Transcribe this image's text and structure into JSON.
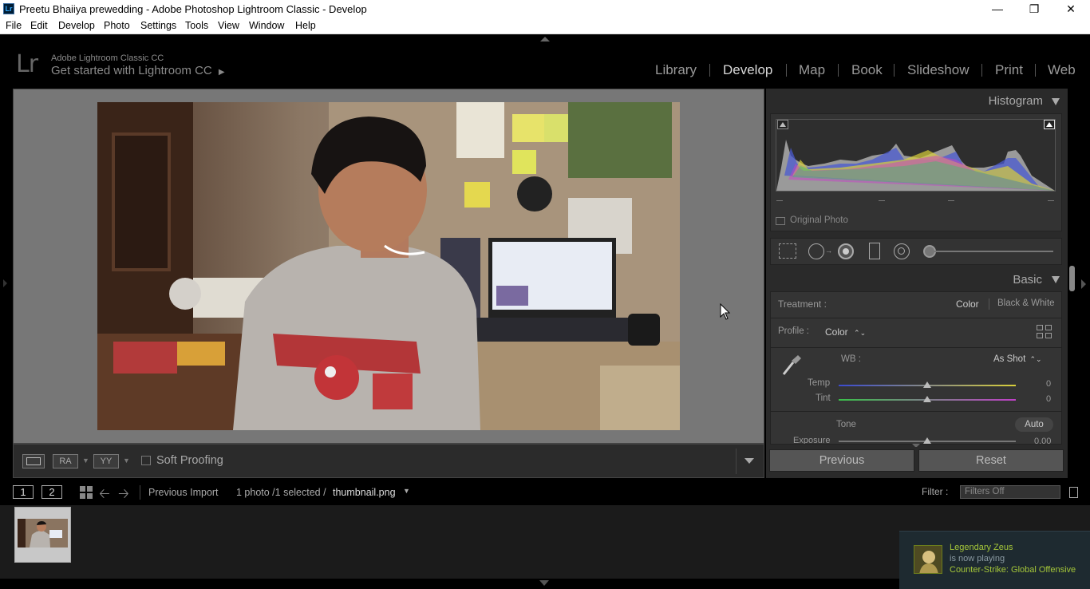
{
  "window": {
    "title": "Preetu Bhaiiya prewedding - Adobe Photoshop Lightroom Classic - Develop",
    "app_icon": "Lr",
    "controls": {
      "minimize": "—",
      "restore": "❐",
      "close": "✕"
    }
  },
  "menu": [
    "File",
    "Edit",
    "Develop",
    "Photo",
    "Settings",
    "Tools",
    "View",
    "Window",
    "Help"
  ],
  "identity": {
    "logo": "Lr",
    "product": "Adobe Lightroom Classic CC",
    "cta": "Get started with Lightroom CC",
    "cta_arrow": "▶"
  },
  "modules": [
    {
      "label": "Library",
      "active": false
    },
    {
      "label": "Develop",
      "active": true
    },
    {
      "label": "Map",
      "active": false
    },
    {
      "label": "Book",
      "active": false
    },
    {
      "label": "Slideshow",
      "active": false
    },
    {
      "label": "Print",
      "active": false
    },
    {
      "label": "Web",
      "active": false
    }
  ],
  "toolbar": {
    "view_modes": [
      "RA",
      "YY"
    ],
    "soft_proofing_label": "Soft Proofing",
    "soft_proofing_checked": false
  },
  "right_panel": {
    "histogram": {
      "title": "Histogram",
      "original_photo_label": "Original Photo",
      "original_photo_checked": false
    },
    "tools": [
      "crop-icon",
      "spot-removal-icon",
      "red-eye-icon",
      "graduated-filter-icon",
      "radial-filter-icon",
      "adjustment-brush-icon"
    ],
    "basic": {
      "title": "Basic",
      "treatment_label": "Treatment :",
      "treatment_options": [
        "Color",
        "Black & White"
      ],
      "treatment_selected": "Color",
      "profile_label": "Profile :",
      "profile_value": "Color",
      "profile_stepper": "⌃⌄",
      "wb_label": "WB :",
      "wb_value": "As Shot",
      "sliders": [
        {
          "label": "Temp",
          "value": "0",
          "fraction": 0.5
        },
        {
          "label": "Tint",
          "value": "0",
          "fraction": 0.5
        }
      ],
      "tone_label": "Tone",
      "auto_label": "Auto",
      "exposure_label": "Exposure",
      "exposure_value": "0.00"
    },
    "previous_label": "Previous",
    "reset_label": "Reset"
  },
  "filmstrip": {
    "screen1": "1",
    "screen2": "2",
    "source": "Previous Import",
    "count": "1 photo /1 selected /",
    "filename": "thumbnail.png",
    "filter_label": "Filter :",
    "filter_value": "Filters Off"
  },
  "notification": {
    "name": "Legendary Zeus",
    "status": "is now playing",
    "game": "Counter-Strike: Global Offensive"
  },
  "colors": {
    "lr_blue": "#31a8ff",
    "steam_green": "#a4c639",
    "panel_bg": "#2a2a2a",
    "canvas_gray": "#777777"
  }
}
